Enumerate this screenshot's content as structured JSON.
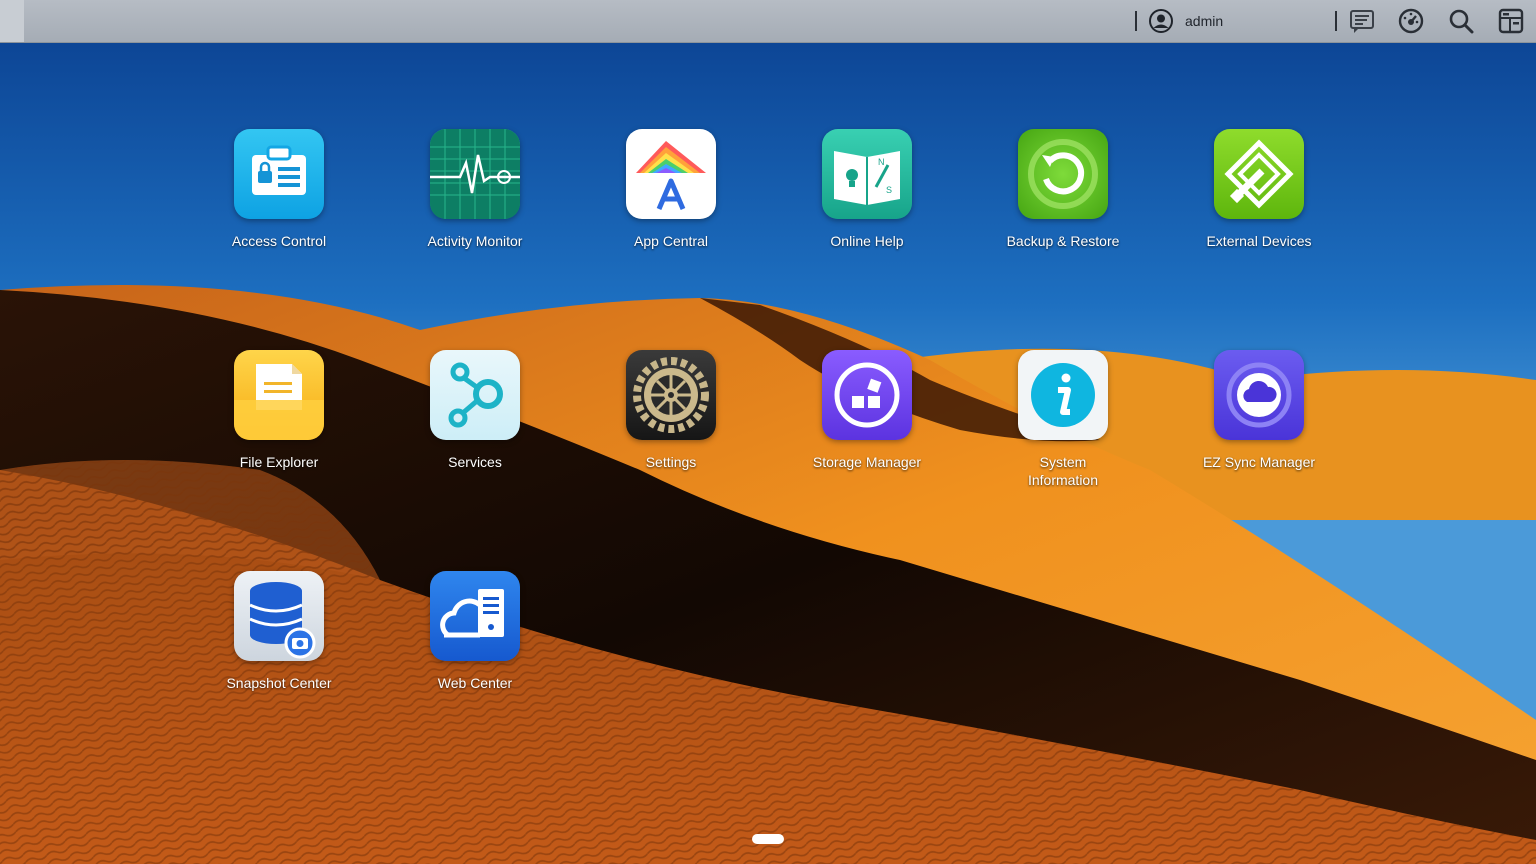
{
  "topbar": {
    "username": "admin",
    "icons": [
      "user-avatar-icon",
      "notification-message-icon",
      "dashboard-gauge-icon",
      "search-icon",
      "task-manager-icon"
    ]
  },
  "apps": [
    {
      "label": "Access Control",
      "icon": "id-card-icon"
    },
    {
      "label": "Activity Monitor",
      "icon": "heartbeat-monitor-icon"
    },
    {
      "label": "App Central",
      "icon": "rainbow-a-icon"
    },
    {
      "label": "Online Help",
      "icon": "map-book-icon"
    },
    {
      "label": "Backup & Restore",
      "icon": "circular-arrow-icon"
    },
    {
      "label": "External Devices",
      "icon": "usb-device-icon"
    },
    {
      "label": "File Explorer",
      "icon": "folder-document-icon"
    },
    {
      "label": "Services",
      "icon": "service-nodes-icon"
    },
    {
      "label": "Settings",
      "icon": "gear-icon"
    },
    {
      "label": "Storage Manager",
      "icon": "storage-blocks-icon"
    },
    {
      "label": "System\nInformation",
      "icon": "info-icon"
    },
    {
      "label": "EZ Sync Manager",
      "icon": "cloud-sync-icon"
    },
    {
      "label": "Snapshot Center",
      "icon": "database-camera-icon"
    },
    {
      "label": "Web Center",
      "icon": "cloud-server-icon"
    }
  ],
  "pagination": {
    "current": 1,
    "total": 1
  }
}
